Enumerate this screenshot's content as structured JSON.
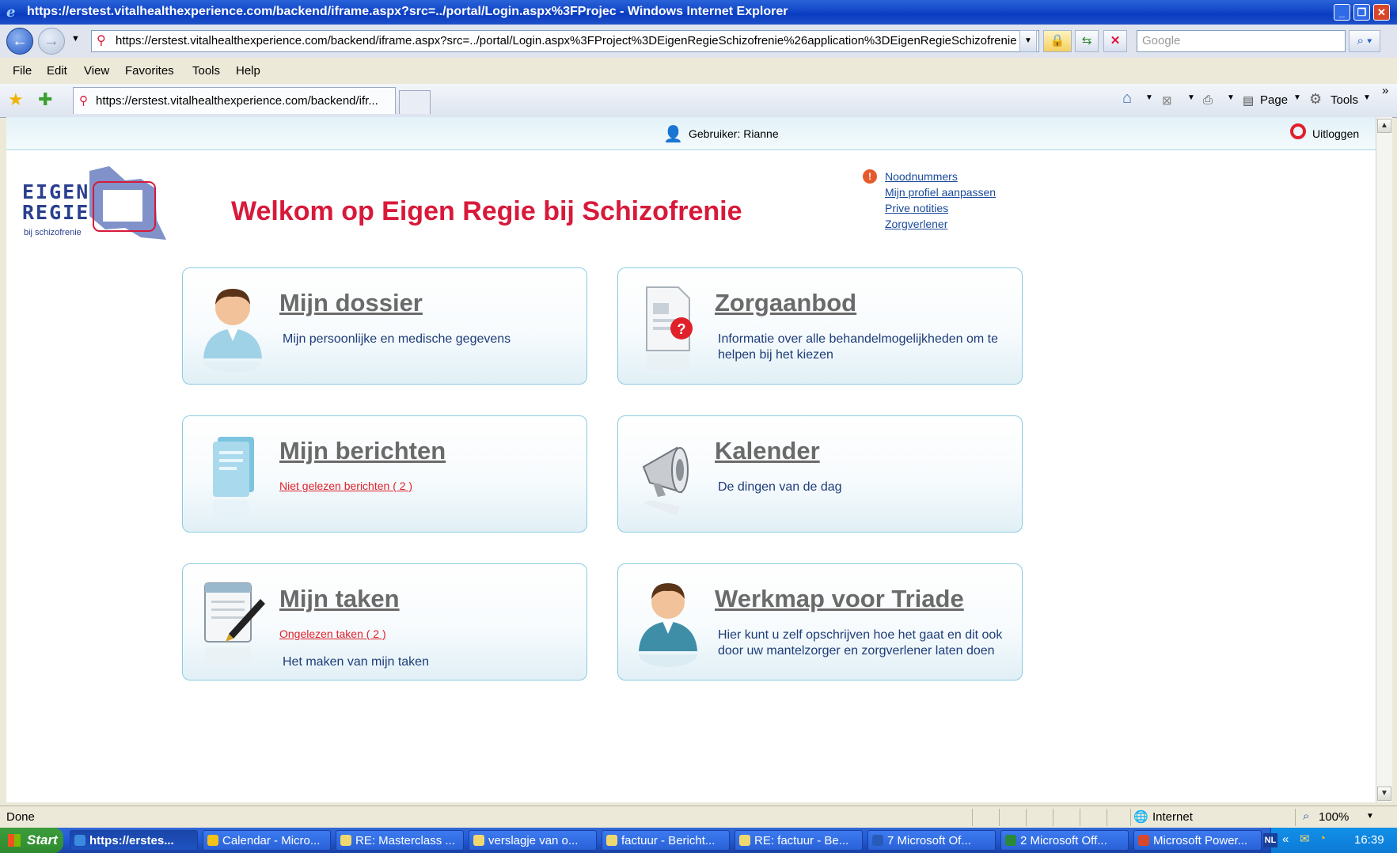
{
  "window": {
    "title": "https://erstest.vitalhealthexperience.com/backend/iframe.aspx?src=../portal/Login.aspx%3FProjec - Windows Internet Explorer"
  },
  "address_bar": {
    "url": "https://erstest.vitalhealthexperience.com/backend/iframe.aspx?src=../portal/Login.aspx%3FProject%3DEigenRegieSchizofrenie%26application%3DEigenRegieSchizofrenie",
    "search_placeholder": "Google"
  },
  "menu": [
    "File",
    "Edit",
    "View",
    "Favorites",
    "Tools",
    "Help"
  ],
  "tab": {
    "label": "https://erstest.vitalhealthexperience.com/backend/ifr..."
  },
  "command_bar": {
    "page_label": "Page",
    "tools_label": "Tools"
  },
  "header": {
    "user_label": "Gebruiker: Rianne",
    "logout_label": "Uitloggen"
  },
  "logo": {
    "line1": "EIGEN",
    "line2": "REGIE",
    "line3": "bij schizofrenie"
  },
  "welcome": "Welkom op Eigen Regie bij Schizofrenie",
  "top_links": [
    "Noodnummers",
    "Mijn profiel aanpassen",
    "Prive notities",
    "Zorgverlener"
  ],
  "cards": [
    {
      "title": "Mijn dossier",
      "desc": "Mijn persoonlijke en medische gegevens"
    },
    {
      "title": "Zorgaanbod",
      "desc": "Informatie over alle behandelmogelijkheden om te helpen bij het kiezen"
    },
    {
      "title": "Mijn berichten",
      "link": "Niet gelezen berichten ( 2 )"
    },
    {
      "title": "Kalender",
      "desc": "De dingen van de dag"
    },
    {
      "title": "Mijn taken",
      "link": "Ongelezen taken ( 2 )",
      "desc": "Het maken van mijn taken"
    },
    {
      "title": "Werkmap voor Triade",
      "desc": "Hier kunt u zelf opschrijven hoe het gaat en dit ook door uw mantelzorger en zorgverlener laten doen"
    }
  ],
  "status_bar": {
    "status": "Done",
    "zone": "Internet",
    "zoom": "100%"
  },
  "taskbar": {
    "start_label": "Start",
    "tasks": [
      "https://erstes...",
      "Calendar - Micro...",
      "RE: Masterclass ...",
      "verslagje van o...",
      "factuur - Bericht...",
      "RE: factuur - Be...",
      "7 Microsoft Of...",
      "2 Microsoft Off...",
      "Microsoft Power..."
    ],
    "lang": "NL",
    "clock": "16:39"
  }
}
